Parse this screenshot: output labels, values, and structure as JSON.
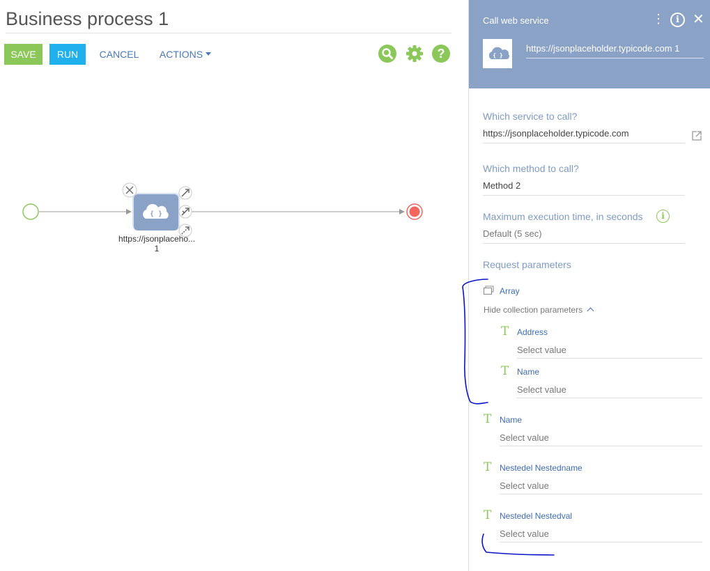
{
  "page": {
    "title": "Business process 1"
  },
  "toolbar": {
    "save_label": "SAVE",
    "run_label": "RUN",
    "cancel_label": "CANCEL",
    "actions_label": "ACTIONS",
    "help_glyph": "?"
  },
  "canvas": {
    "task_label": "https://jsonplaceho...",
    "task_number": "1",
    "task_icon": "web-service-cloud-icon"
  },
  "panel": {
    "title": "Call web service",
    "more_glyph": "⋮",
    "info_glyph": "i",
    "close_glyph": "✕",
    "element_name": "https://jsonplaceholder.typicode.com 1",
    "fields": {
      "service_label": "Which service to call?",
      "service_value": "https://jsonplaceholder.typicode.com",
      "method_label": "Which method to call?",
      "method_value": "Method 2",
      "timeout_label": "Maximum execution time, in seconds",
      "timeout_info_glyph": "i",
      "timeout_value": "Default (5 sec)"
    },
    "request_parameters": {
      "heading": "Request parameters",
      "array_label": "Array",
      "collection_toggle": "Hide collection parameters",
      "collection_items": [
        {
          "type_glyph": "T",
          "name": "Address",
          "placeholder": "Select value"
        },
        {
          "type_glyph": "T",
          "name": "Name",
          "placeholder": "Select value"
        }
      ],
      "items": [
        {
          "type_glyph": "T",
          "name": "Name",
          "placeholder": "Select value"
        },
        {
          "type_glyph": "T",
          "name": "Nestedel Nestedname",
          "placeholder": "Select value"
        },
        {
          "type_glyph": "T",
          "name": "Nestedel Nestedval",
          "placeholder": "Select value"
        }
      ]
    }
  },
  "colors": {
    "green": "#8cc75a",
    "blue_button": "#1fb0ed",
    "panel_header": "#8ba2c7",
    "link_blue": "#3d6cb2",
    "annotation_ink": "#0a14c8",
    "end_event": "#f2665e"
  }
}
